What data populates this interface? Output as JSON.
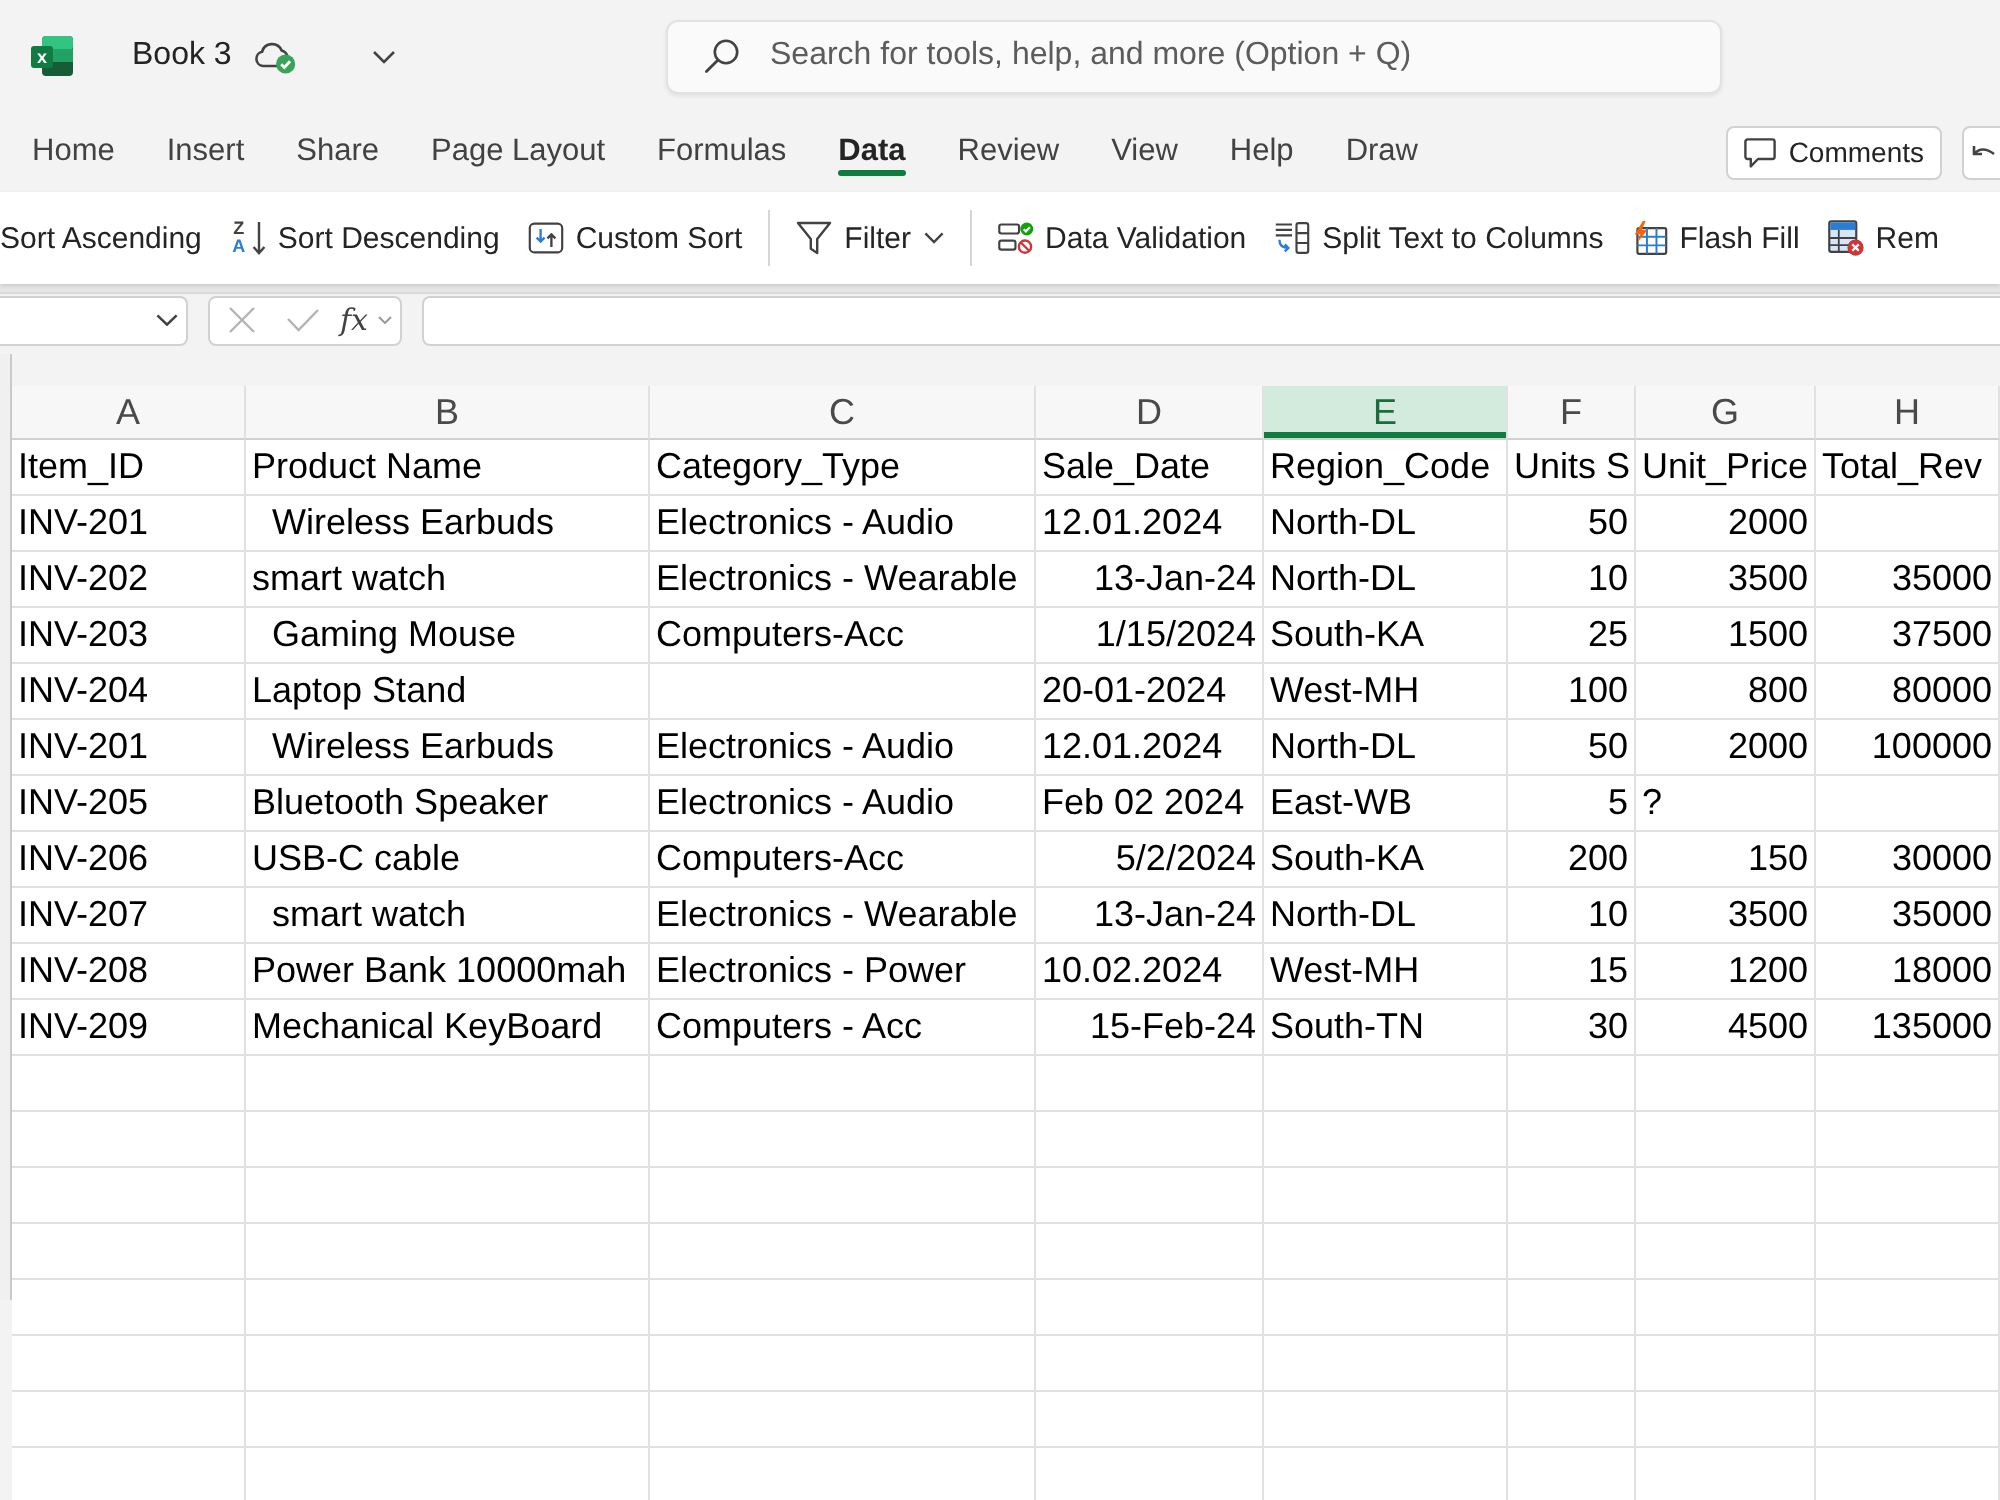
{
  "title_bar": {
    "logo_letter": "x",
    "document_title": "Book 3",
    "search": {
      "placeholder": "Search for tools, help, and more (Option + Q)"
    }
  },
  "tabs": [
    {
      "label": "Home",
      "selected": false
    },
    {
      "label": "Insert",
      "selected": false
    },
    {
      "label": "Share",
      "selected": false
    },
    {
      "label": "Page Layout",
      "selected": false
    },
    {
      "label": "Formulas",
      "selected": false
    },
    {
      "label": "Data",
      "selected": true
    },
    {
      "label": "Review",
      "selected": false
    },
    {
      "label": "View",
      "selected": false
    },
    {
      "label": "Help",
      "selected": false
    },
    {
      "label": "Draw",
      "selected": false
    }
  ],
  "comments_button": {
    "label": "Comments"
  },
  "ribbon": {
    "groups": [
      [
        {
          "kind": "sort_ascending",
          "label": "Sort Ascending",
          "dropdown": false
        },
        {
          "kind": "sort_descending",
          "label": "Sort Descending",
          "icon_letters": [
            "Z",
            "A"
          ],
          "dropdown": false
        },
        {
          "kind": "custom_sort",
          "label": "Custom Sort",
          "dropdown": false
        }
      ],
      [
        {
          "kind": "filter",
          "label": "Filter",
          "dropdown": true
        }
      ],
      [
        {
          "kind": "data_validation",
          "label": "Data Validation",
          "dropdown": false
        },
        {
          "kind": "split_text",
          "label": "Split Text to Columns",
          "dropdown": false
        },
        {
          "kind": "flash_fill",
          "label": "Flash Fill",
          "dropdown": false
        },
        {
          "kind": "remove_duplicates",
          "label": "Rem",
          "dropdown": false
        }
      ]
    ]
  },
  "formula_bar": {
    "function_label": "fx"
  },
  "sheet": {
    "columns": [
      {
        "label": "A",
        "selected": false
      },
      {
        "label": "B",
        "selected": false
      },
      {
        "label": "C",
        "selected": false
      },
      {
        "label": "D",
        "selected": false
      },
      {
        "label": "E",
        "selected": true
      },
      {
        "label": "F",
        "selected": false
      },
      {
        "label": "G",
        "selected": false
      },
      {
        "label": "H",
        "selected": false
      }
    ],
    "rows": [
      {
        "cells": [
          {
            "value": "Item_ID",
            "kind": "text"
          },
          {
            "value": "Product Name",
            "kind": "text"
          },
          {
            "value": "Category_Type",
            "kind": "text"
          },
          {
            "value": "Sale_Date",
            "kind": "text"
          },
          {
            "value": "Region_Code",
            "kind": "text"
          },
          {
            "value": "Units S",
            "kind": "text"
          },
          {
            "value": "Unit_Price",
            "kind": "text"
          },
          {
            "value": "Total_Rev",
            "kind": "text"
          }
        ]
      },
      {
        "cells": [
          {
            "value": "INV-201",
            "kind": "text"
          },
          {
            "value": "  Wireless Earbuds",
            "kind": "text"
          },
          {
            "value": "Electronics - Audio",
            "kind": "text"
          },
          {
            "value": "12.01.2024",
            "kind": "text"
          },
          {
            "value": "North-DL",
            "kind": "text"
          },
          {
            "value": "50",
            "kind": "number"
          },
          {
            "value": "2000",
            "kind": "number"
          },
          {
            "kind": "blank"
          }
        ]
      },
      {
        "cells": [
          {
            "value": "INV-202",
            "kind": "text"
          },
          {
            "value": "smart watch",
            "kind": "text"
          },
          {
            "value": "Electronics - Wearable",
            "kind": "text"
          },
          {
            "value": "13-Jan-24",
            "kind": "number"
          },
          {
            "value": "North-DL",
            "kind": "text"
          },
          {
            "value": "10",
            "kind": "number"
          },
          {
            "value": "3500",
            "kind": "number"
          },
          {
            "value": "35000",
            "kind": "number"
          }
        ]
      },
      {
        "cells": [
          {
            "value": "INV-203",
            "kind": "text"
          },
          {
            "value": "  Gaming Mouse",
            "kind": "text"
          },
          {
            "value": "Computers-Acc",
            "kind": "text"
          },
          {
            "value": "1/15/2024",
            "kind": "number"
          },
          {
            "value": "South-KA",
            "kind": "text"
          },
          {
            "value": "25",
            "kind": "number"
          },
          {
            "value": "1500",
            "kind": "number"
          },
          {
            "value": "37500",
            "kind": "number"
          }
        ]
      },
      {
        "cells": [
          {
            "value": "INV-204",
            "kind": "text"
          },
          {
            "value": "Laptop Stand",
            "kind": "text"
          },
          {
            "kind": "blank"
          },
          {
            "value": "20-01-2024",
            "kind": "text"
          },
          {
            "value": "West-MH",
            "kind": "text"
          },
          {
            "value": "100",
            "kind": "number"
          },
          {
            "value": "800",
            "kind": "number"
          },
          {
            "value": "80000",
            "kind": "number"
          }
        ]
      },
      {
        "cells": [
          {
            "value": "INV-201",
            "kind": "text"
          },
          {
            "value": "  Wireless Earbuds",
            "kind": "text"
          },
          {
            "value": "Electronics - Audio",
            "kind": "text"
          },
          {
            "value": "12.01.2024",
            "kind": "text"
          },
          {
            "value": "North-DL",
            "kind": "text"
          },
          {
            "value": "50",
            "kind": "number"
          },
          {
            "value": "2000",
            "kind": "number"
          },
          {
            "value": "100000",
            "kind": "number"
          }
        ]
      },
      {
        "cells": [
          {
            "value": "INV-205",
            "kind": "text"
          },
          {
            "value": "Bluetooth Speaker",
            "kind": "text"
          },
          {
            "value": "Electronics - Audio",
            "kind": "text"
          },
          {
            "value": "Feb 02 2024",
            "kind": "text"
          },
          {
            "value": "East-WB",
            "kind": "text"
          },
          {
            "value": "5",
            "kind": "number"
          },
          {
            "value": "?",
            "kind": "text"
          },
          {
            "kind": "blank"
          }
        ]
      },
      {
        "cells": [
          {
            "value": "INV-206",
            "kind": "text"
          },
          {
            "value": "USB-C cable",
            "kind": "text"
          },
          {
            "value": "Computers-Acc",
            "kind": "text"
          },
          {
            "value": "5/2/2024",
            "kind": "number"
          },
          {
            "value": "South-KA",
            "kind": "text"
          },
          {
            "value": "200",
            "kind": "number"
          },
          {
            "value": "150",
            "kind": "number"
          },
          {
            "value": "30000",
            "kind": "number"
          }
        ]
      },
      {
        "cells": [
          {
            "value": "INV-207",
            "kind": "text"
          },
          {
            "value": "  smart watch",
            "kind": "text"
          },
          {
            "value": "Electronics - Wearable",
            "kind": "text"
          },
          {
            "value": "13-Jan-24",
            "kind": "number"
          },
          {
            "value": "North-DL",
            "kind": "text"
          },
          {
            "value": "10",
            "kind": "number"
          },
          {
            "value": "3500",
            "kind": "number"
          },
          {
            "value": "35000",
            "kind": "number"
          }
        ]
      },
      {
        "cells": [
          {
            "value": "INV-208",
            "kind": "text"
          },
          {
            "value": "Power Bank 10000mah",
            "kind": "text"
          },
          {
            "value": "Electronics - Power",
            "kind": "text"
          },
          {
            "value": "10.02.2024",
            "kind": "text"
          },
          {
            "value": "West-MH",
            "kind": "text"
          },
          {
            "value": "15",
            "kind": "number"
          },
          {
            "value": "1200",
            "kind": "number"
          },
          {
            "value": "18000",
            "kind": "number"
          }
        ]
      },
      {
        "cells": [
          {
            "value": "INV-209",
            "kind": "text"
          },
          {
            "value": "Mechanical KeyBoard",
            "kind": "text"
          },
          {
            "value": "Computers - Acc",
            "kind": "text"
          },
          {
            "value": "15-Feb-24",
            "kind": "number"
          },
          {
            "value": "South-TN",
            "kind": "text"
          },
          {
            "value": "30",
            "kind": "number"
          },
          {
            "value": "4500",
            "kind": "number"
          },
          {
            "value": "135000",
            "kind": "number"
          }
        ]
      }
    ]
  }
}
